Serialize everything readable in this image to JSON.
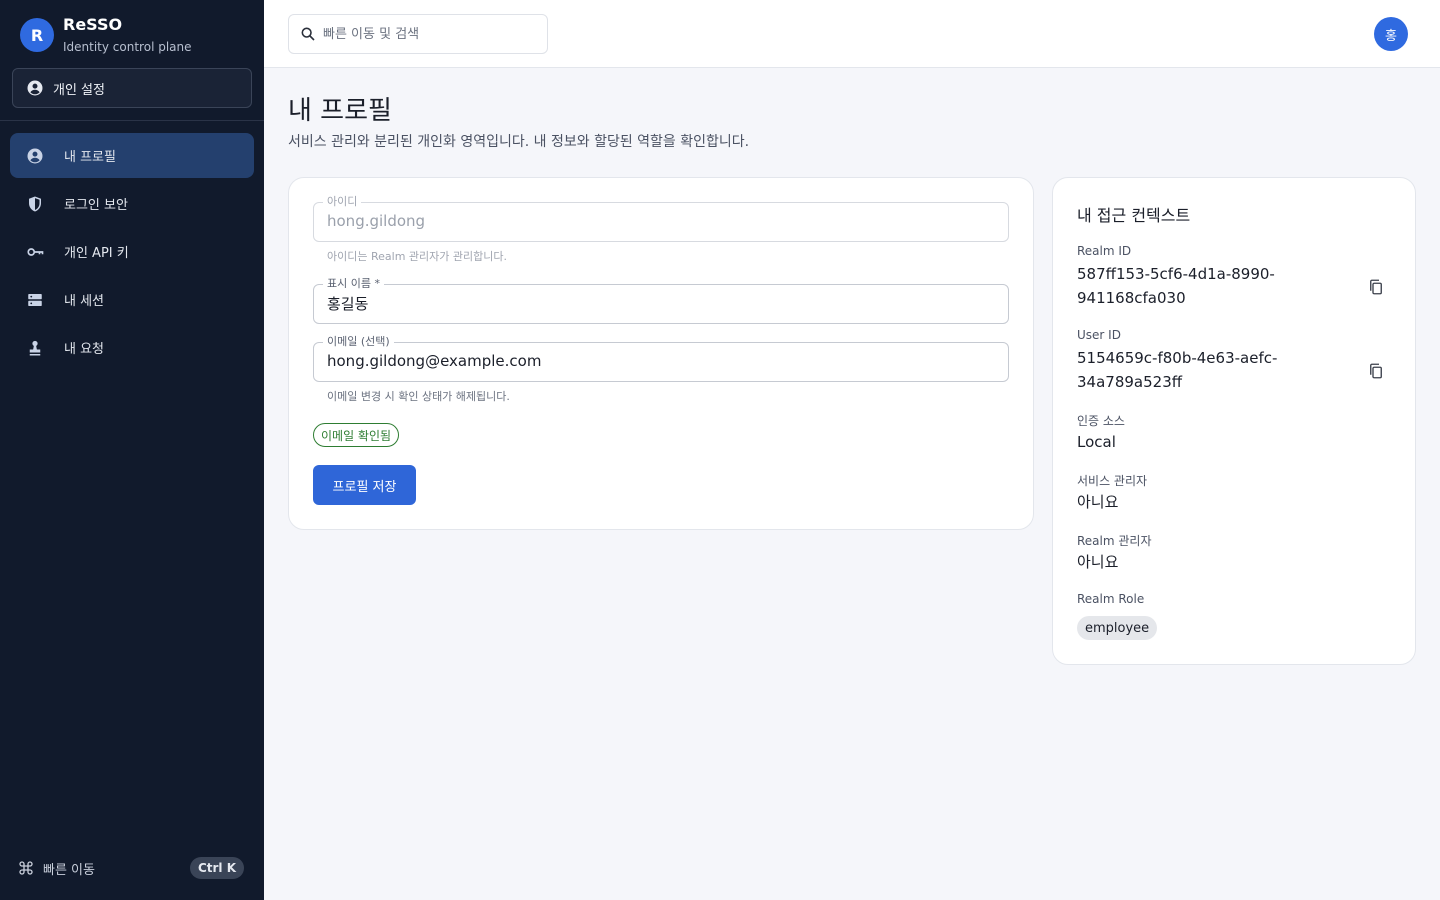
{
  "brand": {
    "logo_letter": "R",
    "name": "ReSSO",
    "subtitle": "Identity control plane"
  },
  "sidebar": {
    "personal_button": "개인 설정",
    "items": [
      {
        "label": "내 프로필",
        "icon": "account-circle-icon",
        "active": true
      },
      {
        "label": "로그인 보안",
        "icon": "shield-icon",
        "active": false
      },
      {
        "label": "개인 API 키",
        "icon": "key-icon",
        "active": false
      },
      {
        "label": "내 세션",
        "icon": "storage-icon",
        "active": false
      },
      {
        "label": "내 요청",
        "icon": "stamp-icon",
        "active": false
      }
    ],
    "footer": {
      "label": "빠른 이동",
      "shortcut": "Ctrl K",
      "icon": "command-icon"
    }
  },
  "topbar": {
    "search_placeholder": "빠른 이동 및 검색",
    "avatar_letter": "홍"
  },
  "page": {
    "title": "내 프로필",
    "description": "서비스 관리와 분리된 개인화 영역입니다. 내 정보와 할당된 역할을 확인합니다."
  },
  "profile_form": {
    "username": {
      "label": "아이디",
      "value": "hong.gildong",
      "helper": "아이디는 Realm 관리자가 관리합니다."
    },
    "display_name": {
      "label": "표시 이름 *",
      "value": "홍길동"
    },
    "email": {
      "label": "이메일 (선택)",
      "value": "hong.gildong@example.com",
      "helper": "이메일 변경 시 확인 상태가 해제됩니다."
    },
    "verified_chip": "이메일 확인됨",
    "save_label": "프로필 저장"
  },
  "access_context": {
    "title": "내 접근 컨텍스트",
    "realm_id_label": "Realm ID",
    "realm_id": "587ff153-5cf6-4d1a-8990-941168cfa030",
    "user_id_label": "User ID",
    "user_id": "5154659c-f80b-4e63-aefc-34a789a523ff",
    "auth_source_label": "인증 소스",
    "auth_source": "Local",
    "service_admin_label": "서비스 관리자",
    "service_admin": "아니요",
    "realm_admin_label": "Realm 관리자",
    "realm_admin": "아니요",
    "realm_role_label": "Realm Role",
    "realm_role": "employee"
  },
  "colors": {
    "sidebar_bg": "#111a2c",
    "active_item": "#24406e",
    "accent": "#2f66d8",
    "success": "#2e7d32"
  }
}
